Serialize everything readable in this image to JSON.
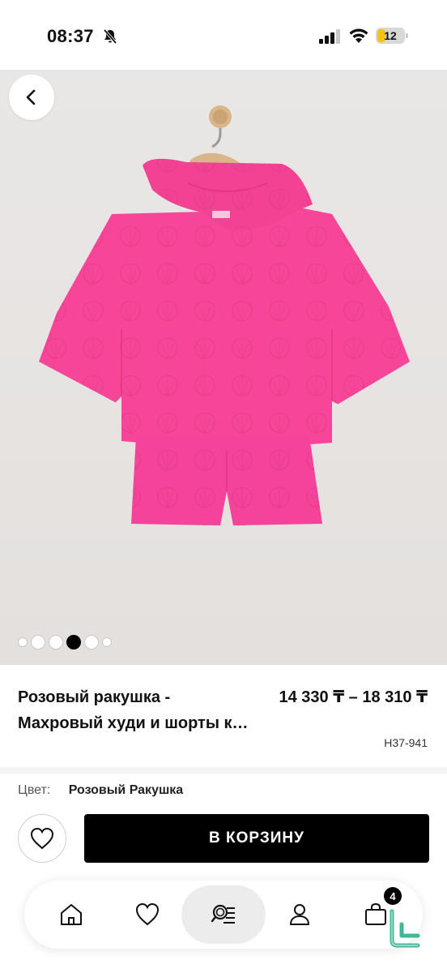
{
  "status_bar": {
    "time": "08:37",
    "battery_level": "12",
    "icons": [
      "bell-slash-icon",
      "signal-icon",
      "wifi-icon",
      "battery-icon"
    ]
  },
  "gallery": {
    "image_count": 6,
    "active_index": 3,
    "back_icon": "chevron-left-icon"
  },
  "product": {
    "title_line1": "Розовый ракушка -",
    "title_line2": "Махровый худи и шорты к…",
    "price": "14 330 ₸ – 18 310 ₸",
    "sku": "H37-941",
    "color_label": "Цвет:",
    "color_value": "Розовый Ракушка"
  },
  "actions": {
    "wishlist_icon": "heart-icon",
    "add_to_cart_label": "В КОРЗИНУ"
  },
  "bottom_nav": {
    "items": [
      {
        "icon": "home-icon"
      },
      {
        "icon": "heart-icon"
      },
      {
        "icon": "search-list-icon",
        "active": true
      },
      {
        "icon": "user-icon"
      },
      {
        "icon": "bag-icon"
      }
    ],
    "cart_count": "4"
  },
  "colors": {
    "accent": "#000000",
    "product_pink": "#f7469a",
    "background": "#ffffff",
    "image_bg": "#e7e4e2"
  }
}
